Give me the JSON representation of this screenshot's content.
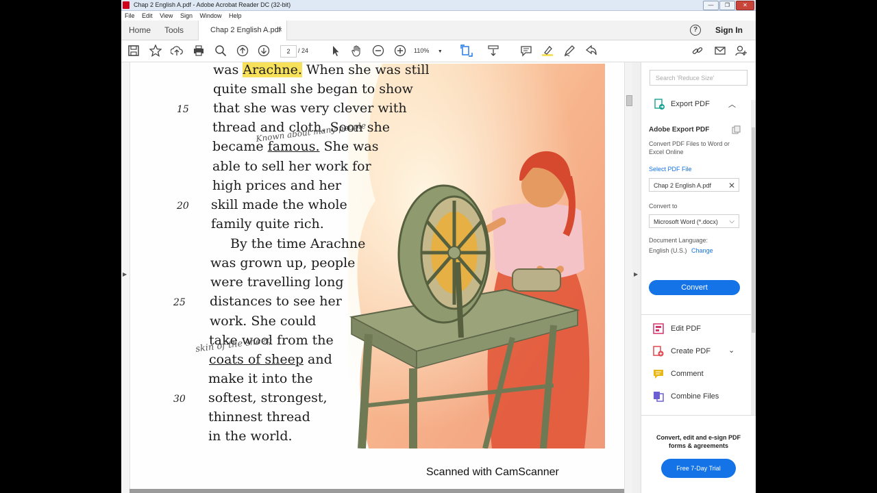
{
  "window": {
    "title": "Chap 2 English A.pdf - Adobe Acrobat Reader DC (32-bit)"
  },
  "menu": [
    "File",
    "Edit",
    "View",
    "Sign",
    "Window",
    "Help"
  ],
  "tabs": {
    "home": "Home",
    "tools": "Tools",
    "document": "Chap 2 English A.pdf",
    "close": "×"
  },
  "header": {
    "sign_in": "Sign In",
    "help": "?"
  },
  "toolbar": {
    "page_current": "2",
    "page_total": "/ 24",
    "zoom": "110%"
  },
  "document": {
    "lines": [
      {
        "num": "",
        "text": "was Arachne. When she was still"
      },
      {
        "num": "",
        "text": "quite small she began to show"
      },
      {
        "num": "15",
        "text": "that she was very clever with"
      },
      {
        "num": "",
        "text": "thread and cloth. Soon she"
      },
      {
        "num": "",
        "text": "became famous. She was"
      },
      {
        "num": "",
        "text": "able to sell her work for"
      },
      {
        "num": "",
        "text": "high prices and her"
      },
      {
        "num": "20",
        "text": "skill made the whole"
      },
      {
        "num": "",
        "text": "family quite rich."
      },
      {
        "num": "",
        "text": "By the time Arachne"
      },
      {
        "num": "",
        "text": "was grown up, people"
      },
      {
        "num": "",
        "text": "were travelling long"
      },
      {
        "num": "25",
        "text": "distances to see her"
      },
      {
        "num": "",
        "text": "work. She could"
      },
      {
        "num": "",
        "text": "take wool from the"
      },
      {
        "num": "",
        "text": "coats of sheep and"
      },
      {
        "num": "",
        "text": "make it into the"
      },
      {
        "num": "30",
        "text": "softest, strongest,"
      },
      {
        "num": "",
        "text": "thinnest thread"
      },
      {
        "num": "",
        "text": "in the world."
      }
    ],
    "handwritten_1": "Known about many people",
    "handwritten_2": "skin of the sheep",
    "watermark": "Scanned with CamScanner"
  },
  "right_panel": {
    "search_placeholder": "Search 'Reduce Size'",
    "export_title": "Export PDF",
    "adobe_export_title": "Adobe Export PDF",
    "description": "Convert PDF Files to Word or Excel Online",
    "select_file_label": "Select PDF File",
    "selected_file": "Chap 2 English A.pdf",
    "convert_to_label": "Convert to",
    "convert_to_value": "Microsoft Word (*.docx)",
    "doc_language_label": "Document Language:",
    "doc_language_value": "English (U.S.)",
    "change_link": "Change",
    "convert_button": "Convert",
    "tools": [
      {
        "label": "Edit PDF",
        "icon": "edit-pdf-icon"
      },
      {
        "label": "Create PDF",
        "icon": "create-pdf-icon"
      },
      {
        "label": "Comment",
        "icon": "comment-icon"
      },
      {
        "label": "Combine Files",
        "icon": "combine-files-icon"
      }
    ],
    "footer_text": "Convert, edit and e-sign PDF forms & agreements",
    "trial_button": "Free 7-Day Trial"
  },
  "colors": {
    "accent": "#1473e6",
    "highlight": "#f7e15a",
    "title_bar": "#dfe9f5"
  }
}
